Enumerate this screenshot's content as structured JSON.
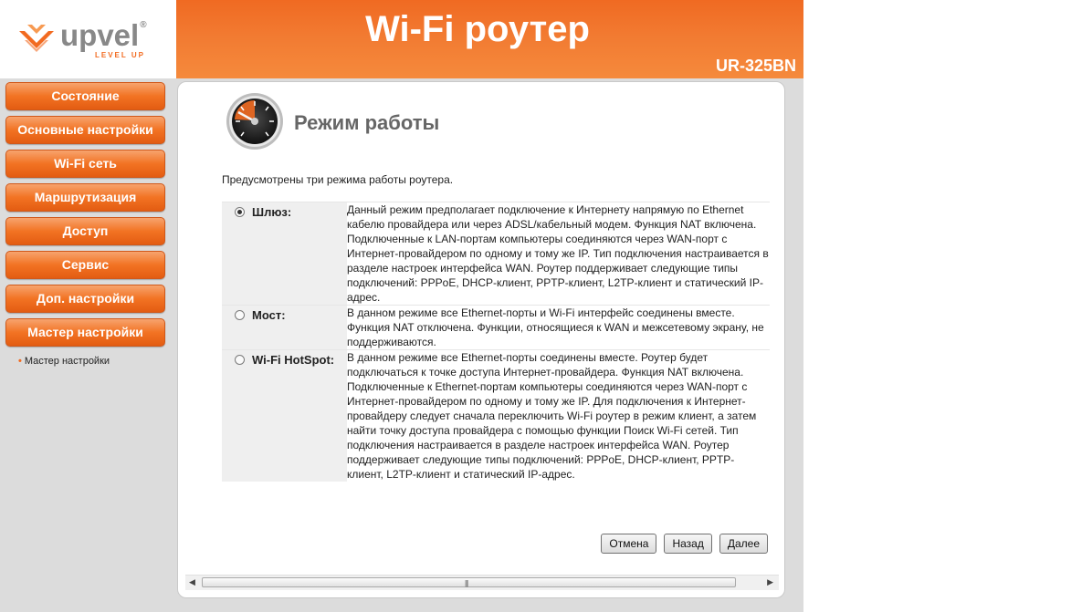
{
  "brand": {
    "logo_text": "upvel",
    "logo_tagline": "LEVEL UP",
    "accent_color": "#f26b21"
  },
  "header": {
    "title": "Wi-Fi роутер",
    "model": "UR-325BN"
  },
  "sidebar": {
    "items": [
      {
        "label": "Состояние"
      },
      {
        "label": "Основные настройки"
      },
      {
        "label": "Wi-Fi сеть"
      },
      {
        "label": "Маршрутизация"
      },
      {
        "label": "Доступ"
      },
      {
        "label": "Сервис"
      },
      {
        "label": "Доп. настройки"
      },
      {
        "label": "Мастер настройки"
      }
    ],
    "subitems": [
      {
        "label": "Мастер настройки"
      }
    ]
  },
  "page": {
    "icon": "gauge-icon",
    "title": "Режим работы",
    "intro": "Предусмотрены три режима работы роутера."
  },
  "modes": [
    {
      "label": "Шлюз:",
      "selected": true,
      "description": "Данный режим предполагает подключение к Интернету напрямую по Ethernet кабелю провайдера или через ADSL/кабельный модем. Функция NAT включена. Подключенные к LAN-портам компьютеры соединяются через WAN-порт с Интернет-провайдером по одному и тому же IP. Тип подключения настраивается в разделе настроек интерфейса WAN. Роутер поддерживает следующие типы подключений: PPPoE, DHCP-клиент, PPTP-клиент, L2TP-клиент и статический IP-адрес."
    },
    {
      "label": "Мост:",
      "selected": false,
      "description": "В данном режиме все Ethernet-порты и Wi-Fi интерфейс соединены вместе. Функция NAT отключена. Функции, относящиеся к WAN и межсетевому экрану, не поддерживаются."
    },
    {
      "label": "Wi-Fi HotSpot:",
      "selected": false,
      "description": "В данном режиме все Ethernet-порты соединены вместе. Роутер будет подключаться к точке доступа Интернет-провайдера. Функция NAT включена. Подключенные к Ethernet-портам компьютеры соединяются через WAN-порт с Интернет-провайдером по одному и тому же IP. Для подключения к Интернет-провайдеру следует сначала переключить Wi-Fi роутер в режим клиент, а затем найти точку доступа провайдера с помощью функции Поиск Wi-Fi сетей. Тип подключения настраивается в разделе настроек интерфейса WAN. Роутер поддерживает следующие типы подключений: PPPoE, DHCP-клиент, PPTP-клиент, L2TP-клиент и статический IP-адрес."
    }
  ],
  "buttons": {
    "cancel": "Отмена",
    "back": "Назад",
    "next": "Далее"
  }
}
